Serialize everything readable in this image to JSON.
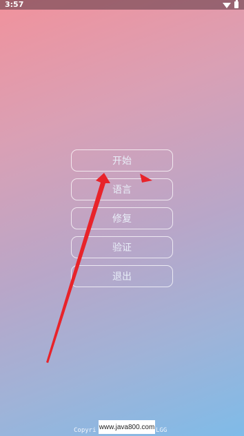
{
  "status_bar": {
    "time": "3:57",
    "icons": [
      "wifi-icon",
      "battery-icon"
    ]
  },
  "menu": {
    "buttons": [
      {
        "label": "开始"
      },
      {
        "label": "语言"
      },
      {
        "label": "修复"
      },
      {
        "label": "验证"
      },
      {
        "label": "退出"
      }
    ]
  },
  "footer": {
    "copyright_prefix": "Copyri",
    "copyright_suffix": "LGG"
  },
  "watermark": {
    "text": "www.java800.com"
  },
  "annotations": {
    "arrow_color": "#e8232a"
  },
  "colors": {
    "gradient_top": "#f1929c",
    "gradient_bottom": "#7fbbe8",
    "button_border": "#ffffff",
    "button_text": "#e8eef8"
  }
}
